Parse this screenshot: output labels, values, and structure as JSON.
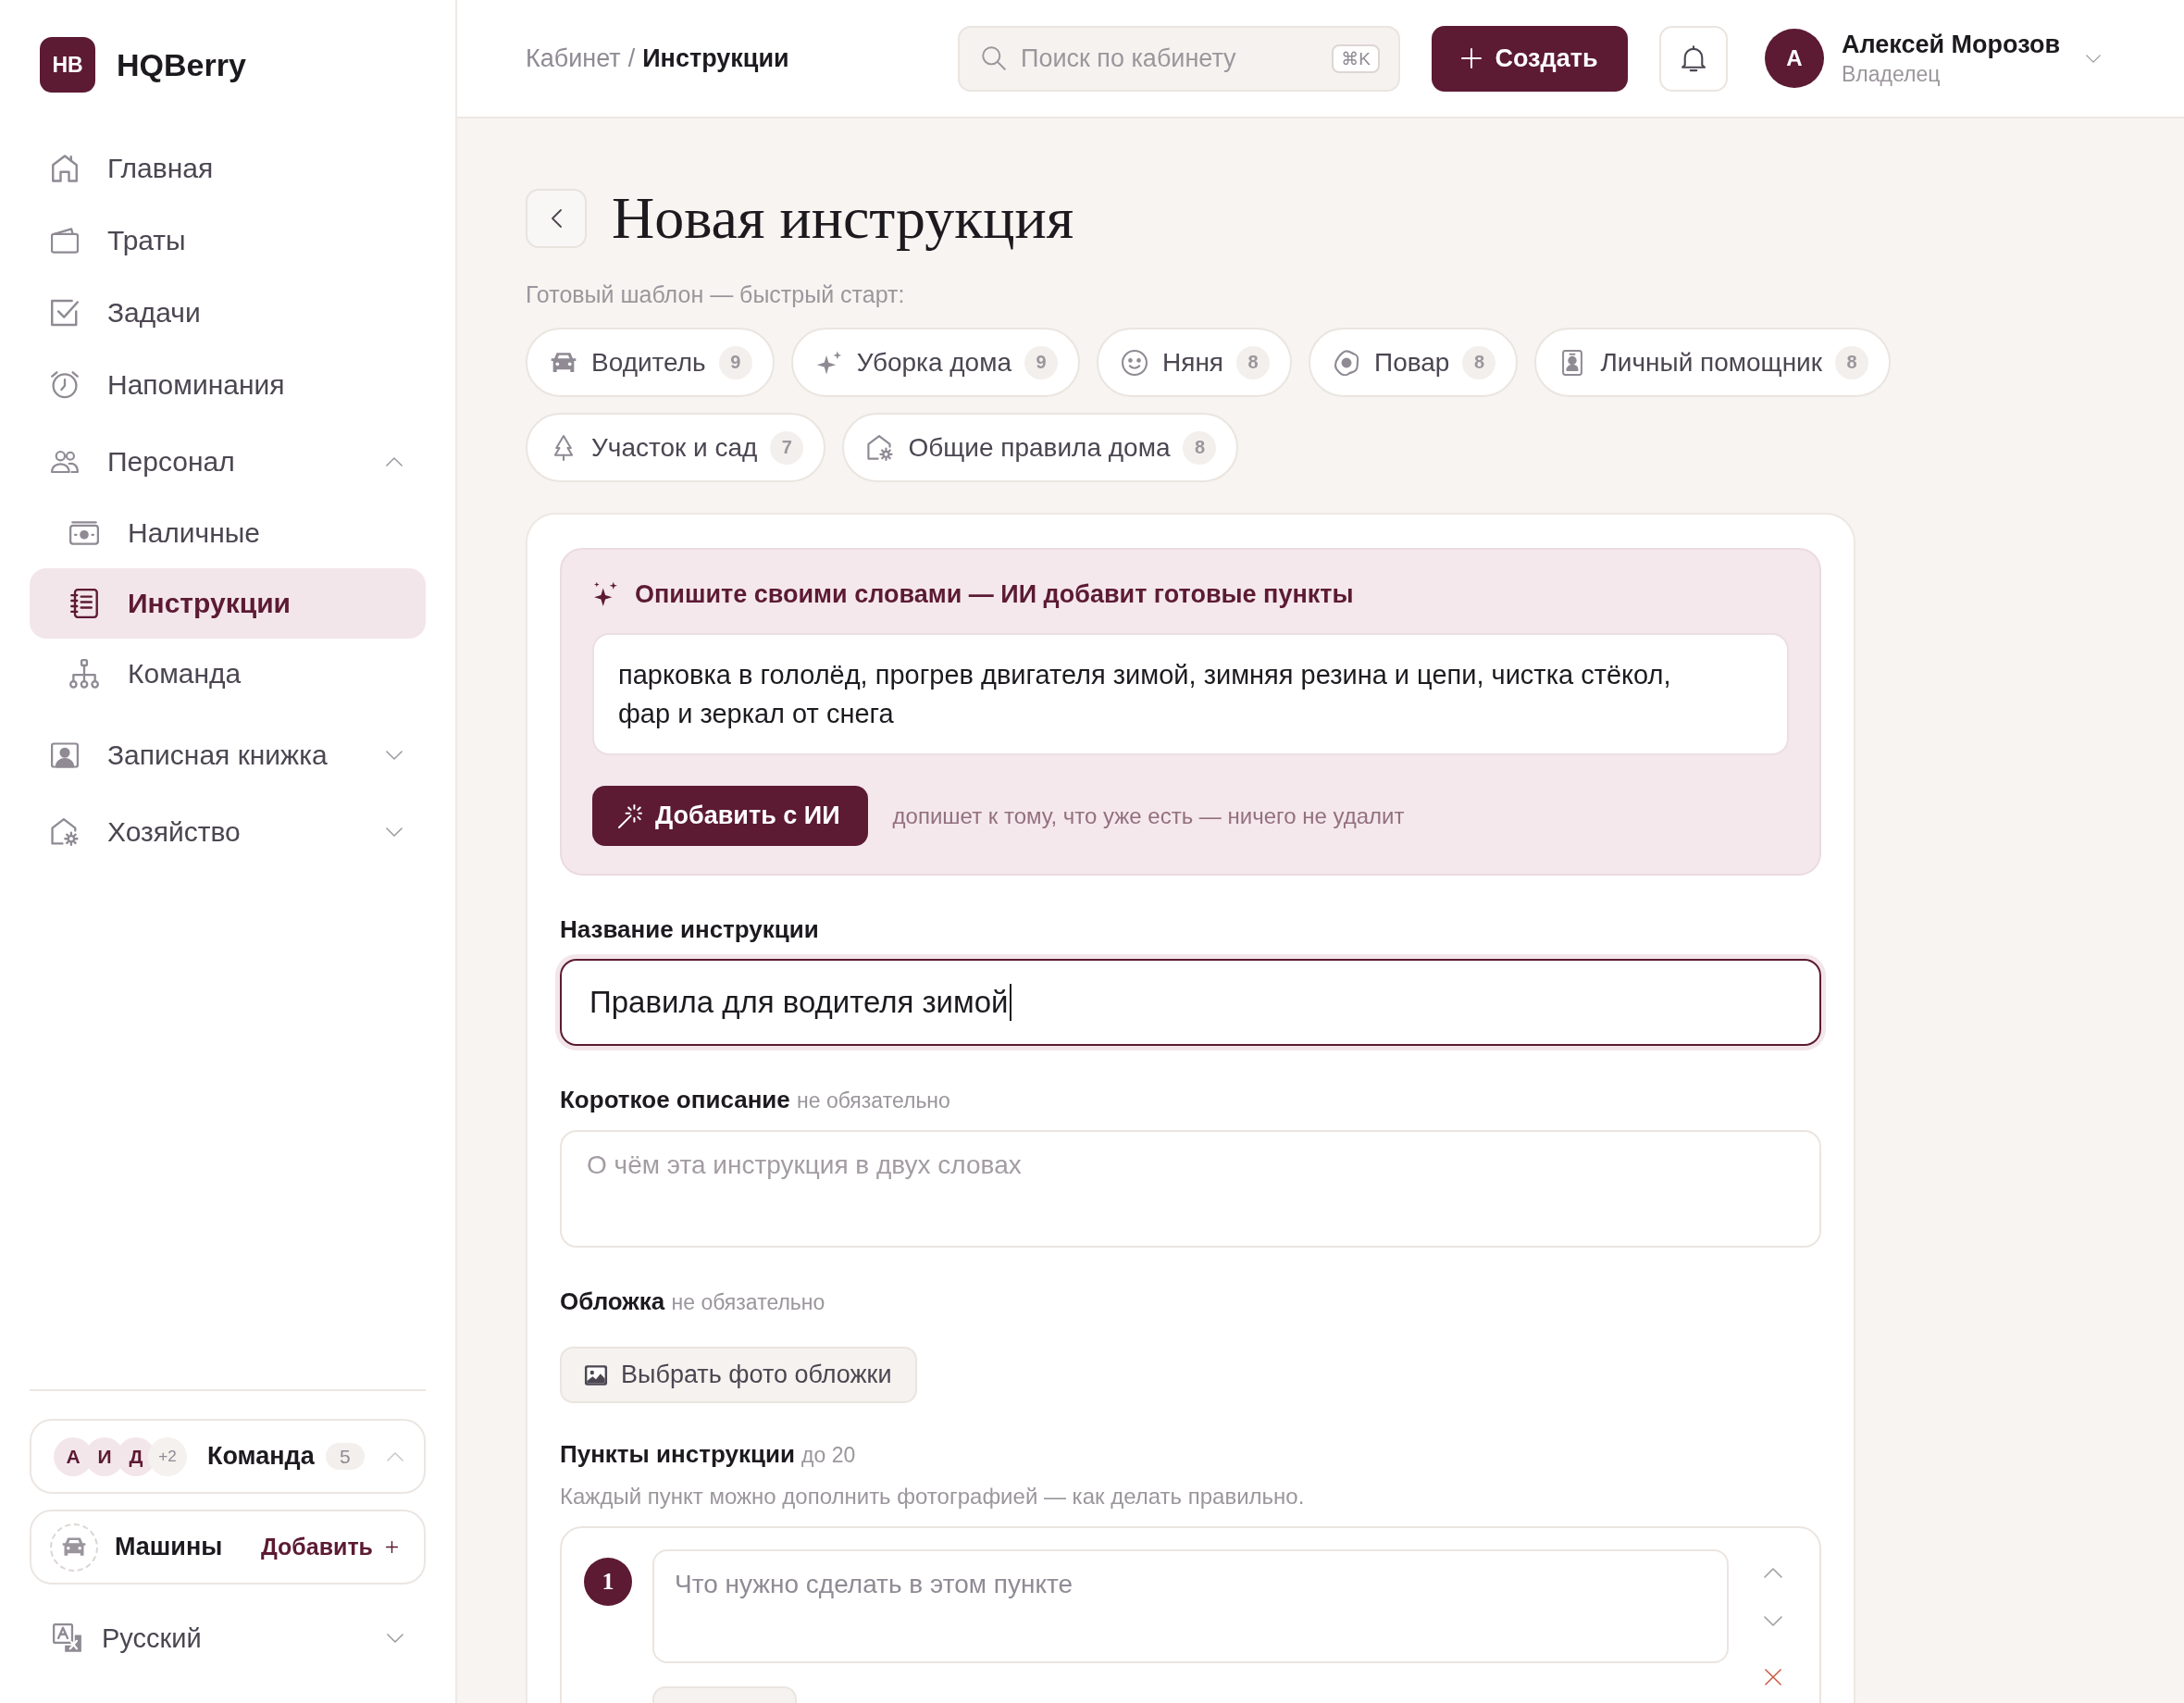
{
  "sidebar": {
    "logo": {
      "mark": "HB",
      "name": "HQBerry"
    },
    "items": [
      {
        "label": "Главная",
        "selected": false
      },
      {
        "label": "Траты",
        "selected": false
      },
      {
        "label": "Задачи",
        "selected": false
      },
      {
        "label": "Напоминания",
        "selected": false
      },
      {
        "label": "Персонал",
        "selected": false,
        "expanded": true,
        "children": [
          {
            "label": "Наличные",
            "selected": false
          },
          {
            "label": "Инструкции",
            "selected": true
          },
          {
            "label": "Команда",
            "selected": false
          }
        ]
      },
      {
        "label": "Записная книжка",
        "selected": false,
        "expanded": false
      },
      {
        "label": "Хозяйство",
        "selected": false,
        "expanded": false
      }
    ],
    "team": {
      "members": [
        "А",
        "И",
        "Д"
      ],
      "more": "+2",
      "label": "Команда",
      "count": "5"
    },
    "cars": {
      "label": "Машины",
      "action": "Добавить"
    },
    "language": {
      "label": "Русский"
    }
  },
  "header": {
    "breadcrumbs": [
      {
        "label": "Кабинет",
        "current": false
      },
      {
        "label": "Инструкции",
        "current": true
      }
    ],
    "separator": "/",
    "search": {
      "placeholder": "Поиск по кабинету",
      "shortcut": "⌘K"
    },
    "create_button": "Создать",
    "user": {
      "initial": "А",
      "name": "Алексей Морозов",
      "role": "Владелец"
    }
  },
  "page": {
    "title": "Новая инструкция",
    "templates_label": "Готовый шаблон — быстрый старт:",
    "templates": [
      {
        "label": "Водитель",
        "count": "9"
      },
      {
        "label": "Уборка дома",
        "count": "9"
      },
      {
        "label": "Няня",
        "count": "8"
      },
      {
        "label": "Повар",
        "count": "8"
      },
      {
        "label": "Личный помощник",
        "count": "8"
      },
      {
        "label": "Участок и сад",
        "count": "7"
      },
      {
        "label": "Общие правила дома",
        "count": "8"
      }
    ],
    "ai": {
      "title": "Опишите своими словами — ИИ добавит готовые пункты",
      "value": "парковка в гололёд, прогрев двигателя зимой, зимняя резина и цепи, чистка стёкол, фар и зеркал от снега",
      "button": "Добавить с ИИ",
      "hint": "допишет к тому, что уже есть — ничего не удалит"
    },
    "form": {
      "title": {
        "label": "Название инструкции",
        "value": "Правила для водителя зимой",
        "focused": true
      },
      "description": {
        "label": "Короткое описание",
        "note": "не обязательно",
        "placeholder": "О чём эта инструкция в двух словах"
      },
      "cover": {
        "label": "Обложка",
        "note": "не обязательно",
        "button": "Выбрать фото обложки"
      },
      "steps": {
        "label": "Пункты инструкции",
        "note": "до 20",
        "hint": "Каждый пункт можно дополнить фотографией — как делать правильно.",
        "items": [
          {
            "number": "1",
            "placeholder": "Что нужно сделать в этом пункте"
          }
        ]
      }
    }
  }
}
